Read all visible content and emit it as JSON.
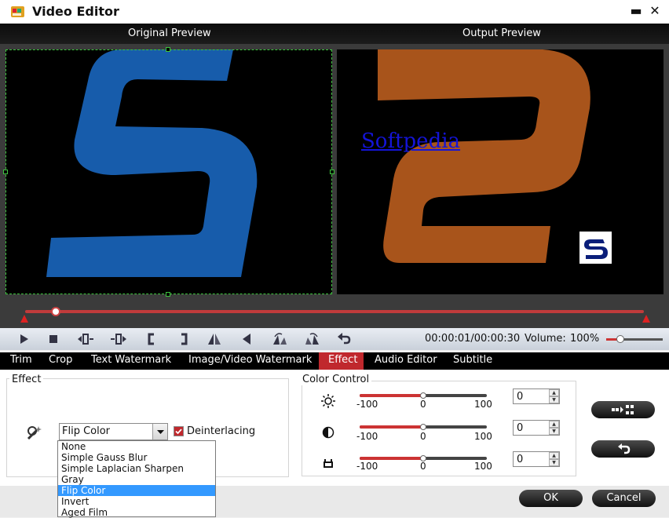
{
  "window": {
    "title": "Video Editor",
    "minimize_glyph": "▬",
    "close_glyph": "✕"
  },
  "preview": {
    "original_label": "Original Preview",
    "output_label": "Output Preview",
    "watermark_text": "Softpedia",
    "watermark_color": "#1414d8",
    "original_logo_color": "#175cab",
    "output_logo_color": "#a8541b",
    "crop_border_color": "#3ec43e"
  },
  "timeline": {
    "position_fraction": 0.05,
    "accent_color": "#c03b3b"
  },
  "controls": {
    "buttons": [
      "play-icon",
      "stop-icon",
      "previous-frame-icon",
      "next-frame-icon",
      "mark-in-icon",
      "mark-out-icon",
      "flip-horizontal-icon",
      "rotate-icon",
      "rotate-left-icon",
      "rotate-right-icon",
      "reset-icon"
    ],
    "time": "00:00:01/00:00:30",
    "volume_label": "Volume:",
    "volume_value": "100%",
    "volume_fraction": 0.25
  },
  "tabs": [
    {
      "label": "Trim",
      "active": false
    },
    {
      "label": "Crop",
      "active": false
    },
    {
      "label": "Text Watermark",
      "active": false
    },
    {
      "label": "Image/Video Watermark",
      "active": false
    },
    {
      "label": "Effect",
      "active": true
    },
    {
      "label": "Audio Editor",
      "active": false
    },
    {
      "label": "Subtitle",
      "active": false
    }
  ],
  "effect": {
    "group_title": "Effect",
    "selected": "Flip Color",
    "options": [
      "None",
      "Simple Gauss Blur",
      "Simple Laplacian Sharpen",
      "Gray",
      "Flip Color",
      "Invert",
      "Aged Film"
    ],
    "selected_index": 4,
    "deinterlacing_label": "Deinterlacing",
    "deinterlacing_checked": true
  },
  "color_control": {
    "group_title": "Color Control",
    "rows": [
      {
        "icon": "brightness-icon",
        "min": "-100",
        "mid": "0",
        "max": "100",
        "value": "0",
        "level_fraction": 0.5
      },
      {
        "icon": "contrast-icon",
        "min": "-100",
        "mid": "0",
        "max": "100",
        "value": "0",
        "level_fraction": 0.5
      },
      {
        "icon": "saturation-icon",
        "min": "-100",
        "mid": "0",
        "max": "100",
        "value": "0",
        "level_fraction": 0.5
      }
    ]
  },
  "side_buttons": {
    "apply_all_icon": "apply-to-all-icon",
    "restore_icon": "restore-icon"
  },
  "dialog": {
    "ok_label": "OK",
    "cancel_label": "Cancel"
  }
}
